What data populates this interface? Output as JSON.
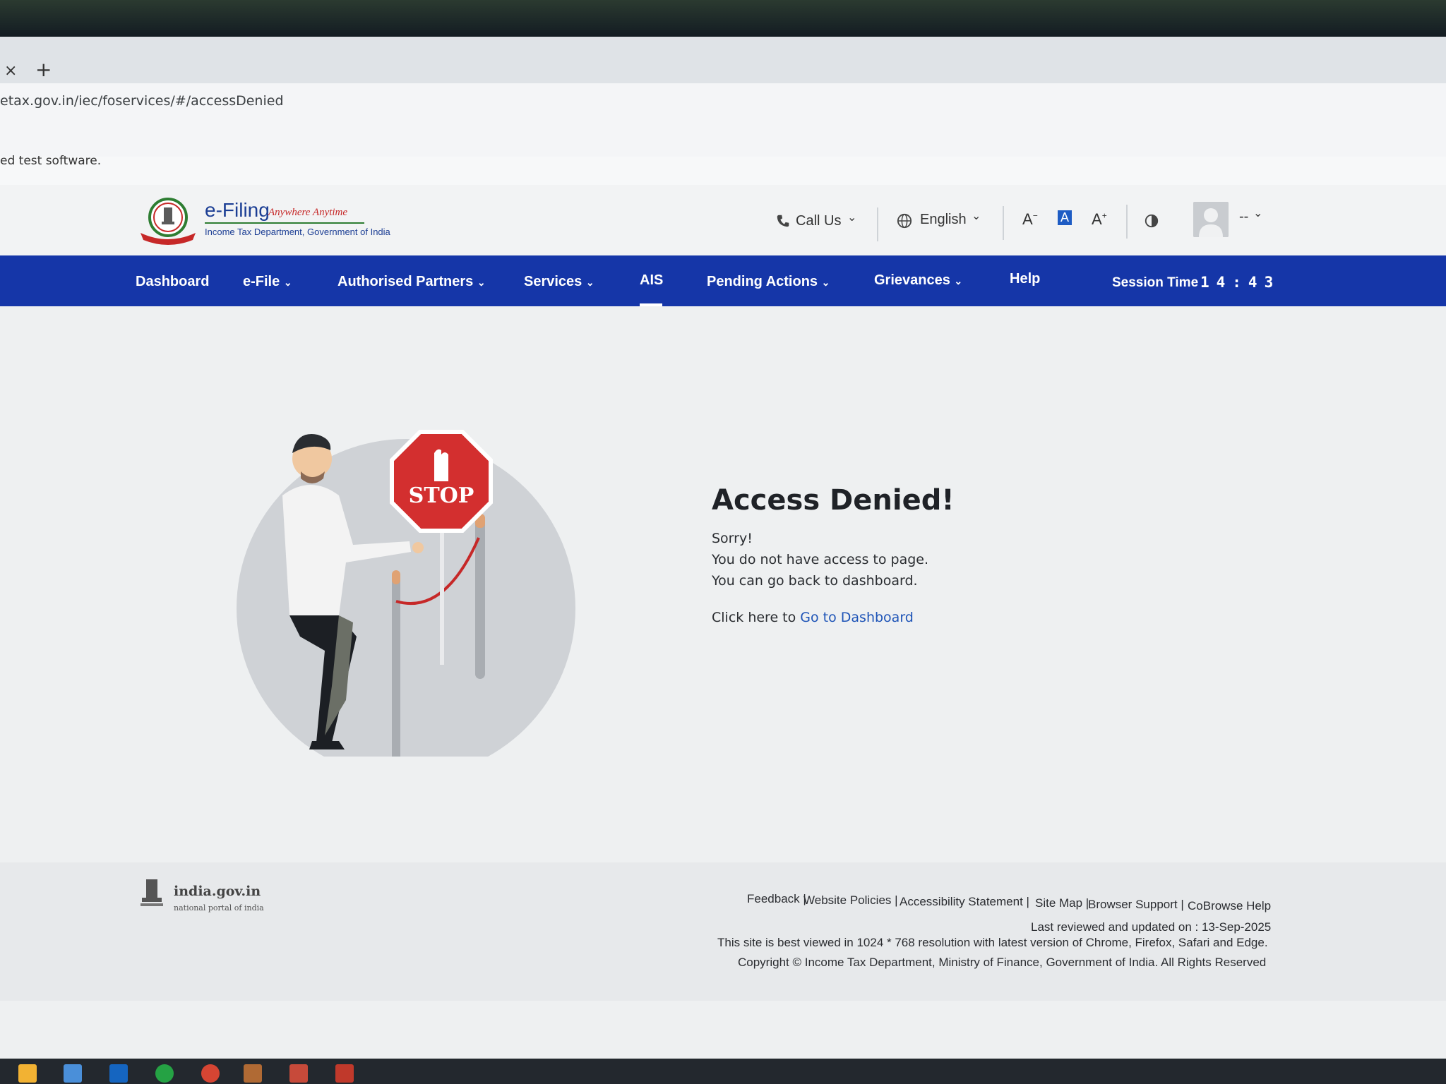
{
  "browser": {
    "tab_close": "×",
    "tab_new": "+",
    "url": "etax.gov.in/iec/foservices/#/accessDenied",
    "infobar_text": "ed test software."
  },
  "header": {
    "logo_title": "e-Filing",
    "logo_tagline": "Anywhere Anytime",
    "logo_subtitle": "Income Tax Department, Government of India",
    "call_us": "Call Us",
    "language": "English",
    "font_decrease": "A",
    "font_default": "A",
    "font_increase": "A",
    "user_name": "--"
  },
  "nav": {
    "items": [
      {
        "label": "Dashboard"
      },
      {
        "label": "e-File"
      },
      {
        "label": "Authorised Partners"
      },
      {
        "label": "Services"
      },
      {
        "label": "AIS"
      },
      {
        "label": "Pending Actions"
      },
      {
        "label": "Grievances"
      },
      {
        "label": "Help"
      }
    ],
    "session_label": "Session Time",
    "session_digits": "14:43"
  },
  "content": {
    "title": "Access Denied!",
    "line1": "Sorry!",
    "line2": "You do not have access to page.",
    "line3": "You can go back to dashboard.",
    "click_prefix": "Click here to ",
    "dashboard_link": "Go to Dashboard",
    "stop_sign": "STOP"
  },
  "footer": {
    "site": "india.gov.in",
    "portal": "national portal of india",
    "links": [
      "Feedback |",
      "Website Policies |",
      "Accessibility Statement |",
      "Site Map |",
      "Browser Support |",
      "CoBrowse Help"
    ],
    "last_reviewed": "Last reviewed and updated on : 13-Sep-2025",
    "best_viewed": "This site is best viewed in 1024 * 768 resolution with latest version of Chrome, Firefox, Safari and Edge.",
    "copyright": "Copyright © Income Tax Department, Ministry of Finance, Government of India. All Rights Reserved"
  },
  "colors": {
    "nav_bg": "#1536a8",
    "link": "#1e54b7",
    "stop_red": "#d32f2f"
  }
}
